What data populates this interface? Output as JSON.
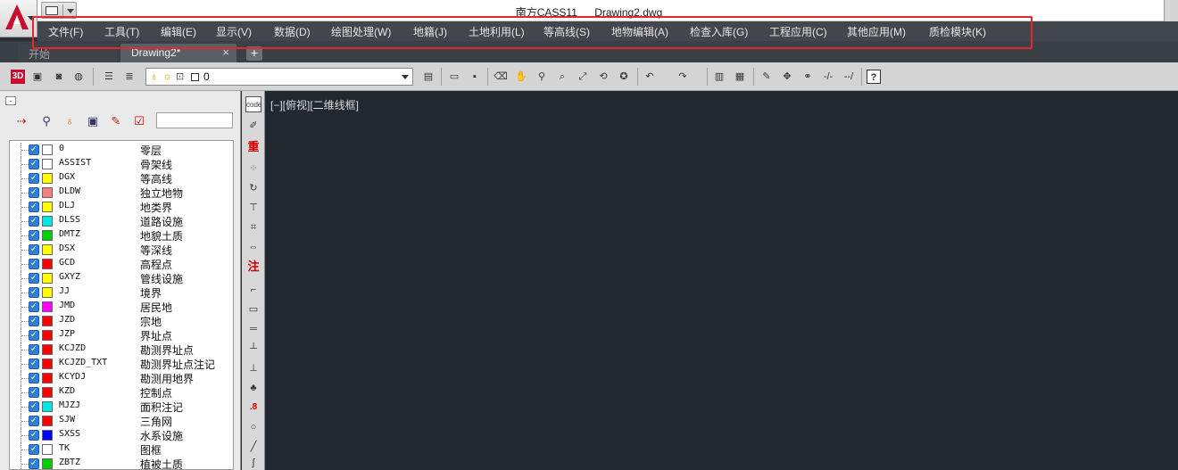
{
  "window": {
    "app_name": "南方CASS11",
    "document_name": "Drawing2.dwg"
  },
  "menu": {
    "items": [
      {
        "label": "文件(F)"
      },
      {
        "label": "工具(T)"
      },
      {
        "label": "编辑(E)"
      },
      {
        "label": "显示(V)"
      },
      {
        "label": "数据(D)"
      },
      {
        "label": "绘图处理(W)"
      },
      {
        "label": "地籍(J)"
      },
      {
        "label": "土地利用(L)"
      },
      {
        "label": "等高线(S)"
      },
      {
        "label": "地物编辑(A)"
      },
      {
        "label": "检查入库(G)"
      },
      {
        "label": "工程应用(C)"
      },
      {
        "label": "其他应用(M)"
      },
      {
        "label": "质检模块(K)"
      }
    ]
  },
  "tabs": {
    "start": "开始",
    "drawing": "Drawing2*",
    "close": "×",
    "add": "+"
  },
  "toolbar": {
    "three_d_label": "3D",
    "current_layer": "0",
    "help_label": "?"
  },
  "layer_panel": {
    "collapse_label": "-",
    "search_value": "",
    "layers": [
      {
        "name": "0",
        "desc": "零层",
        "color": "#ffffff"
      },
      {
        "name": "ASSIST",
        "desc": "骨架线",
        "color": "#ffffff"
      },
      {
        "name": "DGX",
        "desc": "等高线",
        "color": "#ffff00"
      },
      {
        "name": "DLDW",
        "desc": "独立地物",
        "color": "#f08080"
      },
      {
        "name": "DLJ",
        "desc": "地类界",
        "color": "#ffff00"
      },
      {
        "name": "DLSS",
        "desc": "道路设施",
        "color": "#00e5e5"
      },
      {
        "name": "DMTZ",
        "desc": "地貌土质",
        "color": "#00d000"
      },
      {
        "name": "DSX",
        "desc": "等深线",
        "color": "#ffff00"
      },
      {
        "name": "GCD",
        "desc": "高程点",
        "color": "#ff0000"
      },
      {
        "name": "GXYZ",
        "desc": "管线设施",
        "color": "#ffff00"
      },
      {
        "name": "JJ",
        "desc": "境界",
        "color": "#ffff00"
      },
      {
        "name": "JMD",
        "desc": "居民地",
        "color": "#ff00ff"
      },
      {
        "name": "JZD",
        "desc": "宗地",
        "color": "#ff0000"
      },
      {
        "name": "JZP",
        "desc": "界址点",
        "color": "#ff0000"
      },
      {
        "name": "KCJZD",
        "desc": "勘测界址点",
        "color": "#ff0000"
      },
      {
        "name": "KCJZD_TXT",
        "desc": "勘测界址点注记",
        "color": "#ff0000"
      },
      {
        "name": "KCYDJ",
        "desc": "勘测用地界",
        "color": "#ff0000"
      },
      {
        "name": "KZD",
        "desc": "控制点",
        "color": "#ff0000"
      },
      {
        "name": "MJZJ",
        "desc": "面积注记",
        "color": "#00e5e5"
      },
      {
        "name": "SJW",
        "desc": "三角网",
        "color": "#ff0000"
      },
      {
        "name": "SXSS",
        "desc": "水系设施",
        "color": "#0000ff"
      },
      {
        "name": "TK",
        "desc": "图框",
        "color": "#ffffff"
      },
      {
        "name": "ZBTZ",
        "desc": "植被土质",
        "color": "#00d000"
      }
    ]
  },
  "vertical_toolbar": {
    "code_label": "code",
    "chong_label": "重",
    "zhu_label": "注",
    "dot_label": ".8"
  },
  "canvas": {
    "viewport_label": "[−][俯视][二维线框]"
  },
  "colors": {
    "highlight": "#e8262a",
    "canvas_bg": "#212830",
    "menubar_bg": "#43464c"
  }
}
